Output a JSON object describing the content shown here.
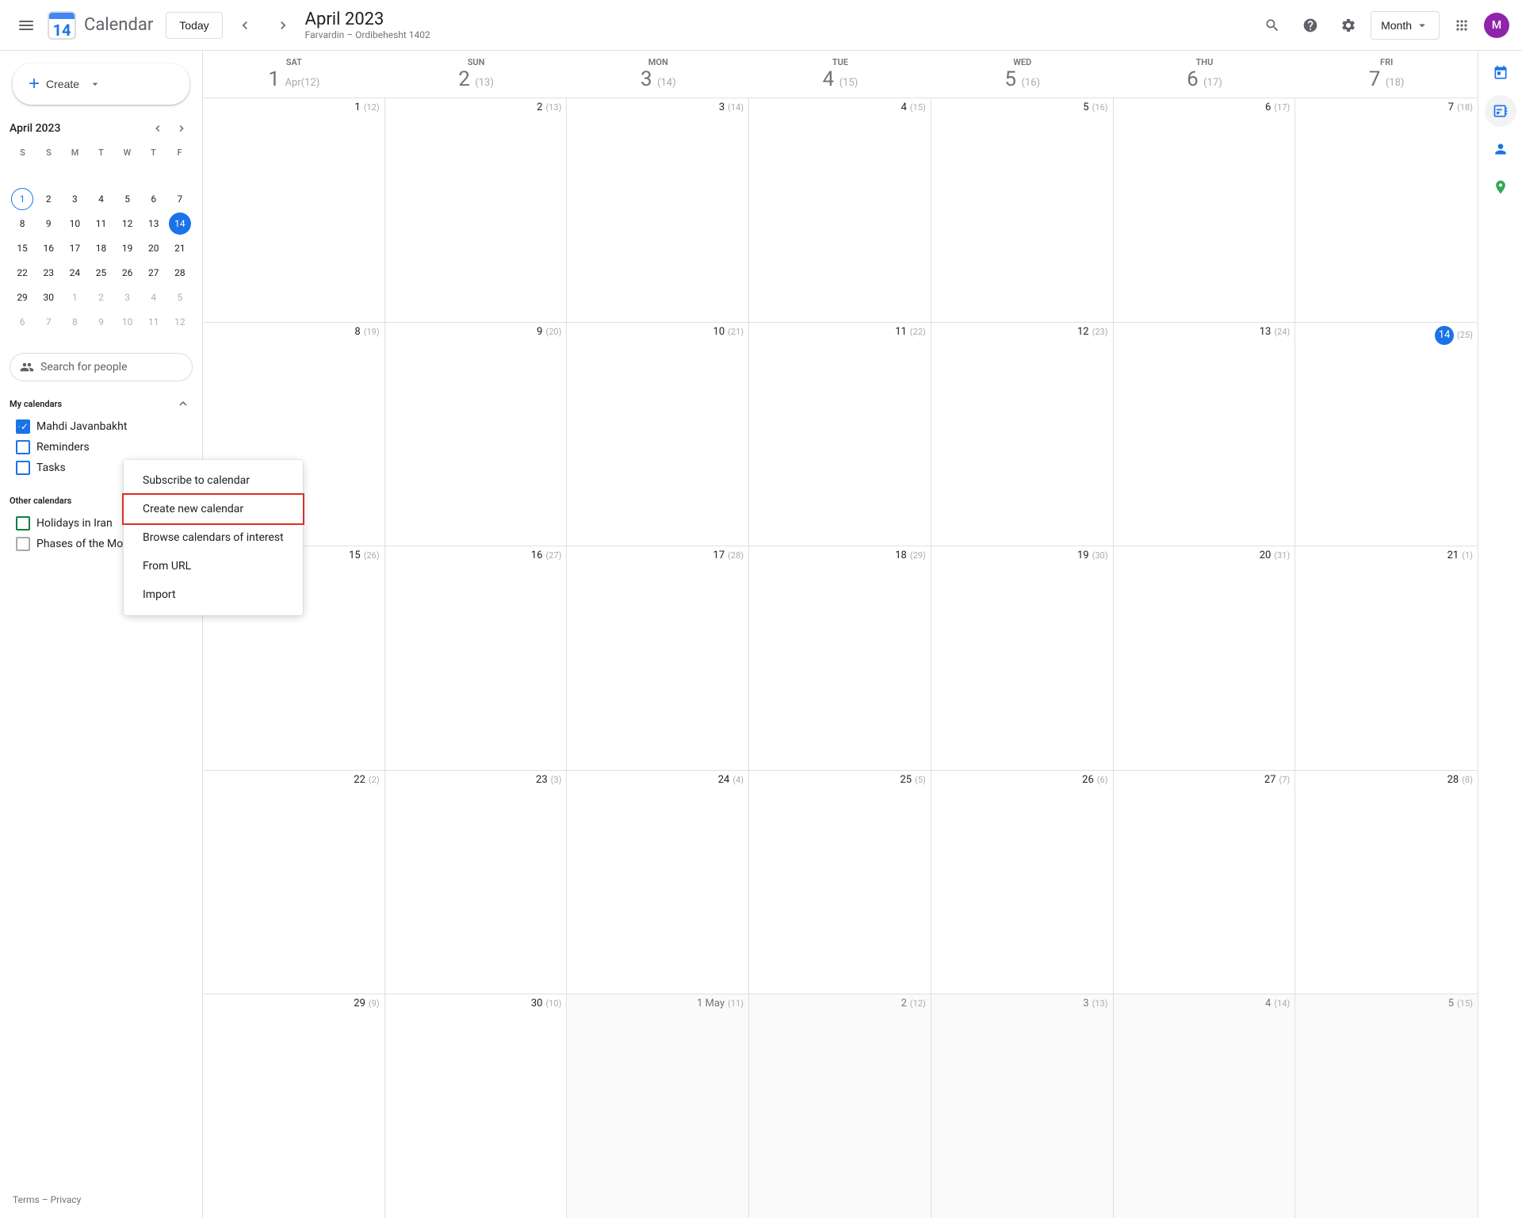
{
  "topbar": {
    "app_name": "Calendar",
    "today_label": "Today",
    "title": "April 2023",
    "subtitle": "Farvardin – Ordibehesht 1402",
    "view_label": "Month",
    "search_tooltip": "Search",
    "help_tooltip": "Help",
    "settings_tooltip": "Settings",
    "apps_tooltip": "Google apps",
    "avatar_letter": "M"
  },
  "sidebar": {
    "create_label": "Create",
    "mini_calendar": {
      "title": "April 2023",
      "weekdays": [
        "S",
        "S",
        "M",
        "T",
        "W",
        "T",
        "F"
      ],
      "weeks": [
        [
          "",
          "",
          "",
          "",
          "",
          "",
          ""
        ],
        [
          "1",
          "2",
          "3",
          "4",
          "5",
          "6",
          "7"
        ],
        [
          "8",
          "9",
          "10",
          "11",
          "12",
          "13",
          "14"
        ],
        [
          "15",
          "16",
          "17",
          "18",
          "19",
          "20",
          "21"
        ],
        [
          "22",
          "23",
          "24",
          "25",
          "26",
          "27",
          "28"
        ],
        [
          "29",
          "30",
          "1",
          "2",
          "3",
          "4",
          "5"
        ]
      ],
      "today": "14",
      "prev_month_tail": [
        "1"
      ],
      "next_month_start": [
        "1",
        "2",
        "3",
        "4",
        "5"
      ]
    },
    "search_people_placeholder": "Search for people",
    "my_calendars_label": "My calendars",
    "my_calendars": [
      {
        "name": "Mahdi Javanbakht",
        "checked": true,
        "color": "#1a73e8"
      },
      {
        "name": "Reminders",
        "checked": false,
        "color": "#1a73e8"
      },
      {
        "name": "Tasks",
        "checked": false,
        "color": "#1a73e8"
      }
    ],
    "other_calendars_label": "Other calendars",
    "other_calendars": [
      {
        "name": "Holidays in Iran",
        "checked": false,
        "color": "#0b8043"
      },
      {
        "name": "Phases of the Mo...",
        "checked": false,
        "color": "#aaaaaa"
      }
    ],
    "footer_terms": "Terms",
    "footer_privacy": "Privacy"
  },
  "context_menu": {
    "items": [
      {
        "label": "Subscribe to calendar",
        "highlighted": false
      },
      {
        "label": "Create new calendar",
        "highlighted": true
      },
      {
        "label": "Browse calendars of interest",
        "highlighted": false
      },
      {
        "label": "From URL",
        "highlighted": false
      },
      {
        "label": "Import",
        "highlighted": false
      }
    ]
  },
  "calendar": {
    "weekdays": [
      "SAT",
      "SUN",
      "MON",
      "TUE",
      "WED",
      "THU",
      "FRI"
    ],
    "rows": [
      [
        {
          "main": "1",
          "persian": "(12)",
          "is_today": false,
          "other_month": false
        },
        {
          "main": "2",
          "persian": "(13)",
          "is_today": false,
          "other_month": false
        },
        {
          "main": "3",
          "persian": "(14)",
          "is_today": false,
          "other_month": false
        },
        {
          "main": "4",
          "persian": "(15)",
          "is_today": false,
          "other_month": false
        },
        {
          "main": "5",
          "persian": "(16)",
          "is_today": false,
          "other_month": false
        },
        {
          "main": "6",
          "persian": "(17)",
          "is_today": false,
          "other_month": false
        },
        {
          "main": "7",
          "persian": "(18)",
          "is_today": false,
          "other_month": false
        }
      ],
      [
        {
          "main": "8",
          "persian": "(19)",
          "is_today": false,
          "other_month": false
        },
        {
          "main": "9",
          "persian": "(20)",
          "is_today": false,
          "other_month": false
        },
        {
          "main": "10",
          "persian": "(21)",
          "is_today": false,
          "other_month": false
        },
        {
          "main": "11",
          "persian": "(22)",
          "is_today": false,
          "other_month": false
        },
        {
          "main": "12",
          "persian": "(23)",
          "is_today": false,
          "other_month": false
        },
        {
          "main": "13",
          "persian": "(24)",
          "is_today": false,
          "other_month": false
        },
        {
          "main": "14",
          "persian": "(25)",
          "is_today": true,
          "other_month": false
        }
      ],
      [
        {
          "main": "15",
          "persian": "(26)",
          "is_today": false,
          "other_month": false
        },
        {
          "main": "16",
          "persian": "(27)",
          "is_today": false,
          "other_month": false
        },
        {
          "main": "17",
          "persian": "(28)",
          "is_today": false,
          "other_month": false
        },
        {
          "main": "18",
          "persian": "(29)",
          "is_today": false,
          "other_month": false
        },
        {
          "main": "19",
          "persian": "(30)",
          "is_today": false,
          "other_month": false
        },
        {
          "main": "20",
          "persian": "(31)",
          "is_today": false,
          "other_month": false
        },
        {
          "main": "21",
          "persian": "(1)",
          "is_today": false,
          "other_month": false
        }
      ],
      [
        {
          "main": "22",
          "persian": "(2)",
          "is_today": false,
          "other_month": false
        },
        {
          "main": "23",
          "persian": "(3)",
          "is_today": false,
          "other_month": false
        },
        {
          "main": "24",
          "persian": "(4)",
          "is_today": false,
          "other_month": false
        },
        {
          "main": "25",
          "persian": "(5)",
          "is_today": false,
          "other_month": false
        },
        {
          "main": "26",
          "persian": "(6)",
          "is_today": false,
          "other_month": false
        },
        {
          "main": "27",
          "persian": "(7)",
          "is_today": false,
          "other_month": false
        },
        {
          "main": "28",
          "persian": "(8)",
          "is_today": false,
          "other_month": false
        }
      ],
      [
        {
          "main": "29",
          "persian": "(9)",
          "is_today": false,
          "other_month": false
        },
        {
          "main": "30",
          "persian": "(10)",
          "is_today": false,
          "other_month": false
        },
        {
          "main": "1 May",
          "persian": "(11)",
          "is_today": false,
          "other_month": true
        },
        {
          "main": "2",
          "persian": "(12)",
          "is_today": false,
          "other_month": true
        },
        {
          "main": "3",
          "persian": "(13)",
          "is_today": false,
          "other_month": true
        },
        {
          "main": "4",
          "persian": "(14)",
          "is_today": false,
          "other_month": true
        },
        {
          "main": "5",
          "persian": "(15)",
          "is_today": false,
          "other_month": true
        }
      ]
    ]
  },
  "right_sidebar": {
    "icons": [
      "calendar-icon",
      "tasks-icon",
      "contacts-icon",
      "maps-icon"
    ]
  }
}
